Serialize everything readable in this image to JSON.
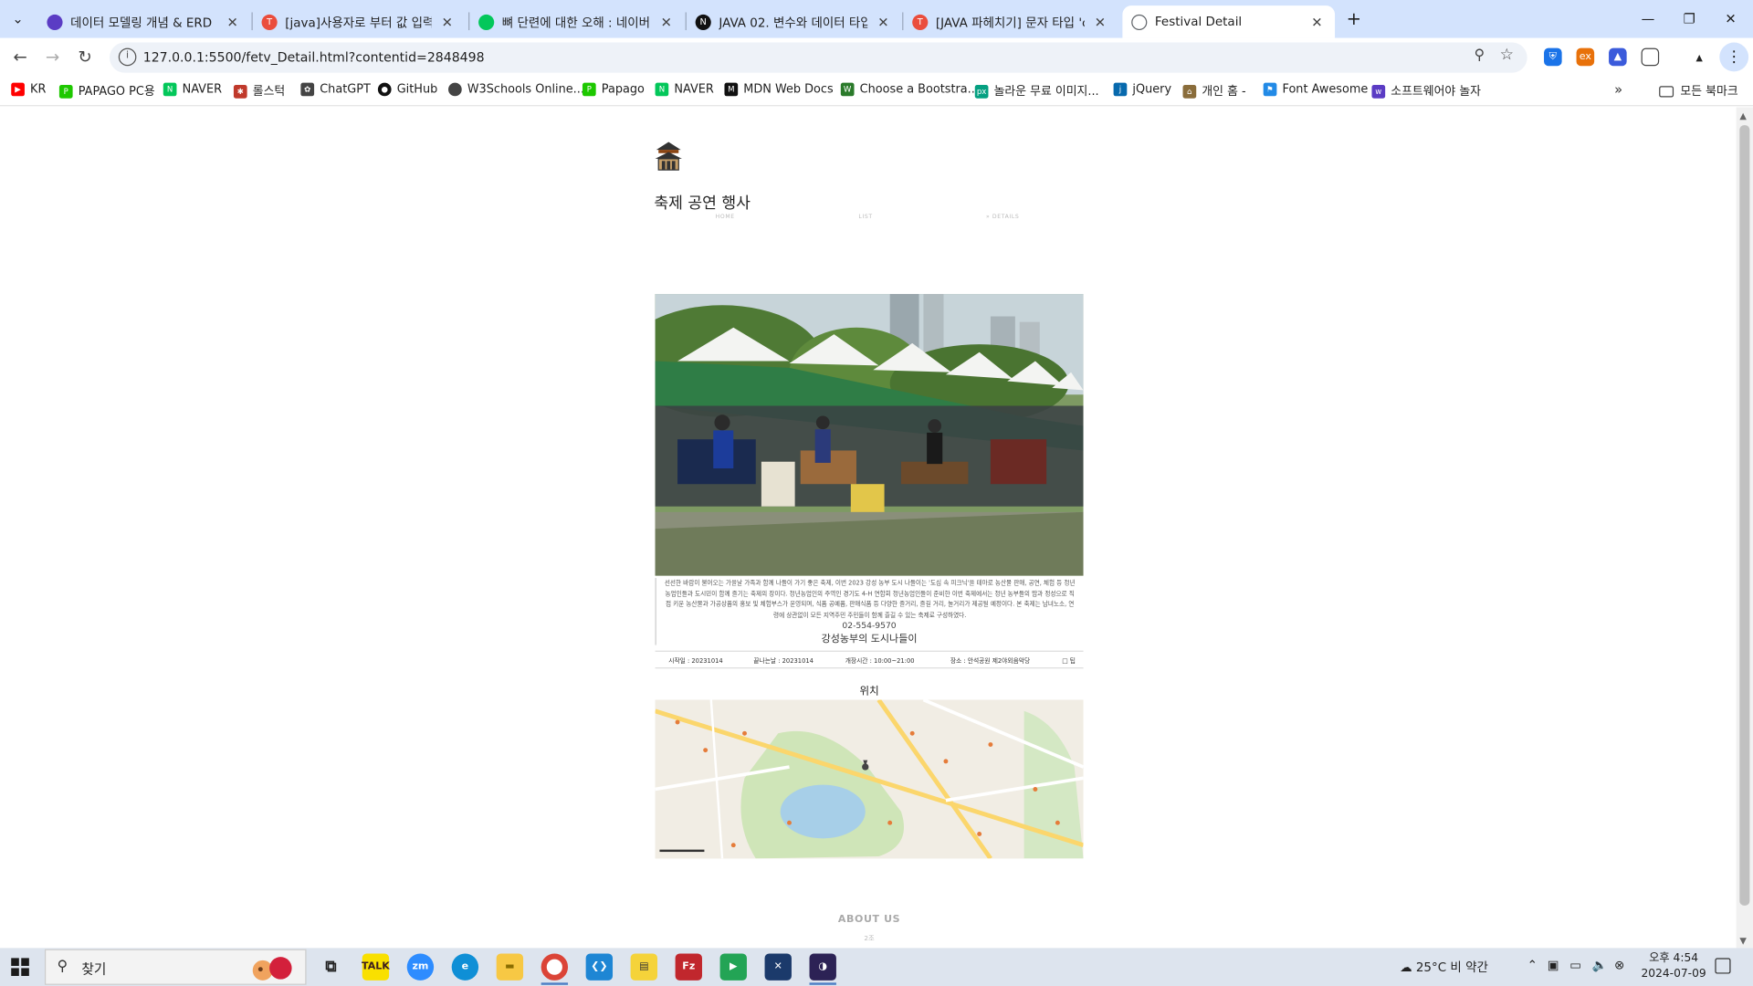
{
  "browser": {
    "tabs": [
      {
        "label": "데이터 모델링 개념 & ERD",
        "favicon_color": "#5b3cc4"
      },
      {
        "label": "[java]사용자로 부터 값 입력받",
        "favicon_color": "#ea4d3d"
      },
      {
        "label": "뼈 단련에 대한 오해 : 네이버",
        "favicon_color": "#03c75a"
      },
      {
        "label": "JAVA 02. 변수와 데이터 타입",
        "favicon_color": "#111111"
      },
      {
        "label": "[JAVA 파헤치기] 문자 타입 'cha",
        "favicon_color": "#ea4d3d"
      },
      {
        "label": "Festival Detail",
        "favicon_color": "#5f6368"
      }
    ],
    "new_tab": "+",
    "url": "127.0.0.1:5500/fetv_Detail.html?contentid=2848498",
    "bookmarks": [
      {
        "label": "KR",
        "color": "#ff0000"
      },
      {
        "label": "PAPAGO PC용",
        "color": "#1ec800"
      },
      {
        "label": "NAVER",
        "color": "#03c75a"
      },
      {
        "label": "롤스턱",
        "color": "#c0392b"
      },
      {
        "label": "ChatGPT",
        "color": "#444444"
      },
      {
        "label": "GitHub",
        "color": "#111111"
      },
      {
        "label": "W3Schools Online...",
        "color": "#444444"
      },
      {
        "label": "Papago",
        "color": "#1ec800"
      },
      {
        "label": "NAVER",
        "color": "#03c75a"
      },
      {
        "label": "MDN Web Docs",
        "color": "#111111"
      },
      {
        "label": "Choose a Bootstra...",
        "color": "#2a7a2a"
      },
      {
        "label": "놀라운 무료 이미지...",
        "color": "#05a081"
      },
      {
        "label": "jQuery",
        "color": "#0769ad"
      },
      {
        "label": "개인 홈 -",
        "color": "#8a6d3b"
      },
      {
        "label": "Font Awesome",
        "color": "#228ae6"
      },
      {
        "label": "소프트웨어야 놀자",
        "color": "#5b3cc4"
      }
    ],
    "all_bookmarks": "모든 북마크"
  },
  "page": {
    "title": "축제 공연 행사",
    "breadcrumb": [
      "HOME",
      "LIST",
      "DETAILS"
    ],
    "description": "선선한 바람이 불어오는 가을날 가족과 함께 나들이 가기 좋은 축제, 이번 2023 강성 농부 도시 나들이는 '도심 속 피크닉'을 테마로 농산물 판매, 공연, 체험 등 청년농업인들과 도시민이 함께 즐기는 축제의 장이다. 청년농업인의 주역인 경기도 4-H 연합회 청년농업인들이 준비한 이번 축제에서는 청년 농부들의 땀과 정성으로 직접 키운 농산물과 가공상품의 홍보 및 체험부스가 운영되며, 식품 공예품, 판매식품 등 다양한 즐거리, 즐길 거리, 놀거리가 제공될 예정이다. 본 축제는 남녀노소, 연령에 상관없이 모든 지역주민 주민들이 함께 즐길 수 있는 축제로 구성하였다.",
    "phone": "02-554-9570",
    "event_name": "강성농부의 도시나들이",
    "info": {
      "start": "시작일 : 20231014",
      "end": "끝나는날 : 20231014",
      "hours": "개장시간 : 10:00~21:00",
      "place": "장소 : 안석공원 제2야외음악당",
      "extra": "□ 팁"
    },
    "location_title": "위치",
    "footer_title": "ABOUT US",
    "footer_sub": "2조"
  },
  "taskbar": {
    "search_placeholder": "찾기",
    "weather": "25°C 비 약간",
    "time": "오후 4:54",
    "date": "2024-07-09"
  }
}
